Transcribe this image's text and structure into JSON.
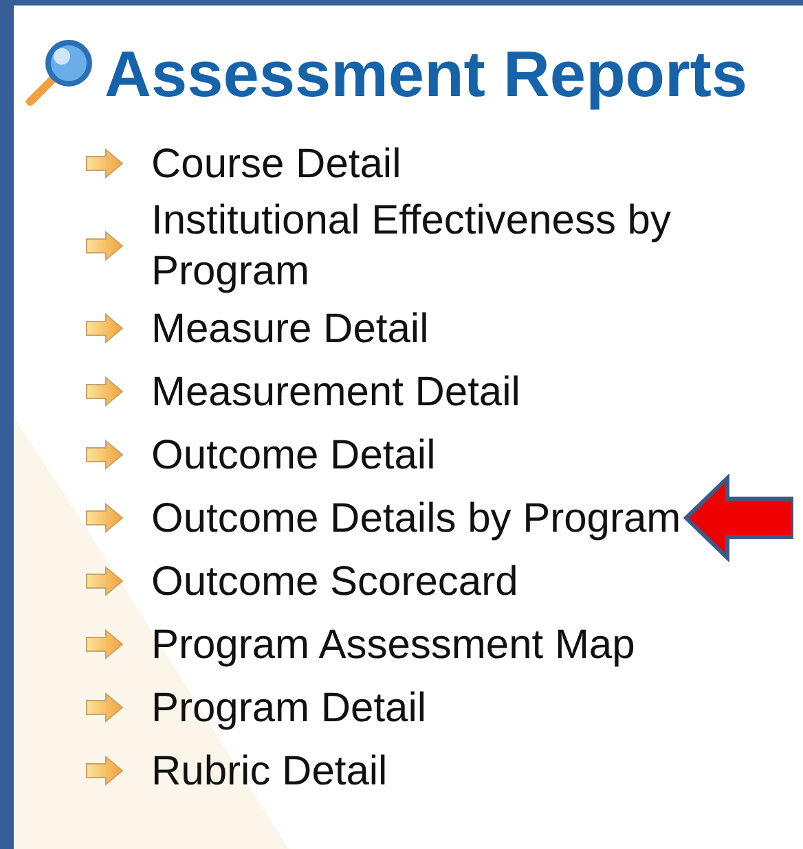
{
  "title": "Assessment Reports",
  "reports": [
    {
      "label": "Course Detail",
      "pointed": false
    },
    {
      "label": "Institutional Effectiveness by Program",
      "pointed": false
    },
    {
      "label": "Measure Detail",
      "pointed": false
    },
    {
      "label": "Measurement Detail",
      "pointed": false
    },
    {
      "label": "Outcome Detail",
      "pointed": false
    },
    {
      "label": "Outcome Details by Program",
      "pointed": true
    },
    {
      "label": "Outcome Scorecard",
      "pointed": false
    },
    {
      "label": "Program Assessment Map",
      "pointed": false
    },
    {
      "label": "Program Detail",
      "pointed": false
    },
    {
      "label": "Rubric Detail",
      "pointed": false
    }
  ]
}
